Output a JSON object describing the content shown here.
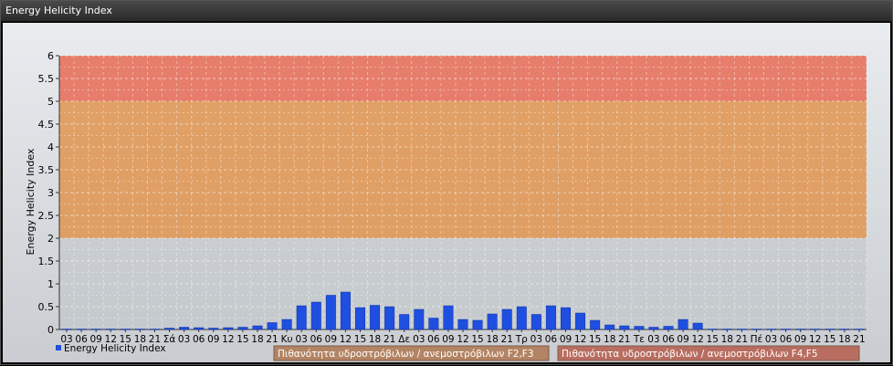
{
  "window": {
    "title": "Energy Helicity Index"
  },
  "chart_data": {
    "type": "bar",
    "title": "",
    "ylabel": "Energy Helicity Index",
    "xlabel": "",
    "ylim": [
      0,
      6
    ],
    "yticks": [
      "0",
      "0.5",
      "1",
      "1.5",
      "2",
      "2.5",
      "3",
      "3.5",
      "4",
      "4.5",
      "5",
      "5.5",
      "6"
    ],
    "grid": true,
    "categories": [
      "03",
      "06",
      "09",
      "12",
      "15",
      "18",
      "21",
      "Σά",
      "03",
      "06",
      "09",
      "12",
      "15",
      "18",
      "21",
      "Κυ",
      "03",
      "06",
      "09",
      "12",
      "15",
      "18",
      "21",
      "Δε",
      "03",
      "06",
      "09",
      "12",
      "15",
      "18",
      "21",
      "Τρ",
      "03",
      "06",
      "09",
      "12",
      "15",
      "18",
      "21",
      "Τε",
      "03",
      "06",
      "09",
      "12",
      "15",
      "18",
      "21",
      "Πέ",
      "03",
      "06",
      "09",
      "12",
      "15",
      "18",
      "21"
    ],
    "series": [
      {
        "name": "Energy Helicity Index",
        "color": "#1f4fe0",
        "values": [
          0.01,
          0.01,
          0.01,
          0.01,
          0.01,
          0.01,
          0.01,
          0.03,
          0.05,
          0.04,
          0.03,
          0.04,
          0.05,
          0.08,
          0.15,
          0.22,
          0.52,
          0.6,
          0.75,
          0.82,
          0.48,
          0.53,
          0.5,
          0.33,
          0.44,
          0.25,
          0.52,
          0.22,
          0.2,
          0.34,
          0.44,
          0.5,
          0.33,
          0.52,
          0.48,
          0.36,
          0.2,
          0.1,
          0.08,
          0.07,
          0.05,
          0.07,
          0.22,
          0.14,
          0.01,
          0.01,
          0.01,
          0.01,
          0.01,
          0.01,
          0.01,
          0.01,
          0.01,
          0.01,
          0.01
        ]
      }
    ],
    "bands": [
      {
        "from": 2,
        "to": 5,
        "color": "#e0944f",
        "label": "Πιθανότητα υδροστρόβιλων / ανεμοστρόβιλων F2,F3"
      },
      {
        "from": 5,
        "to": 6,
        "color": "#e66b55",
        "label": "Πιθανότητα υδροστρόβιλων / ανεμοστρόβιλων F4,F5"
      }
    ],
    "legend_placement": "bottom-left"
  }
}
